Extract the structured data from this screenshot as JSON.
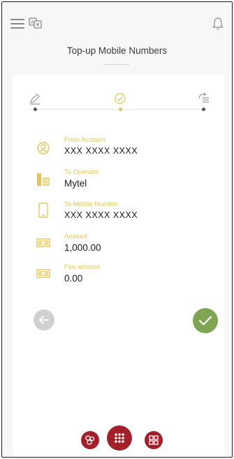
{
  "header": {
    "title": "Top-up Mobile Numbers",
    "subtitle_dots": "............"
  },
  "icons": {
    "menu": "hamburger-menu-icon",
    "language": "language-toggle-icon",
    "notifications": "bell-icon"
  },
  "stepper": {
    "steps": [
      {
        "icon": "pencil-icon",
        "state": "done"
      },
      {
        "icon": "check-circle-icon",
        "state": "active"
      },
      {
        "icon": "send-list-icon",
        "state": "pending"
      }
    ]
  },
  "fields": [
    {
      "label": "From Account",
      "value": "XXX XXXX XXXX",
      "icon": "user-circle-icon"
    },
    {
      "label": "To Operator",
      "value": "Mytel",
      "icon": "building-icon"
    },
    {
      "label": "To Mobile Number",
      "value": "XXX XXXX XXXX",
      "icon": "mobile-phone-icon"
    },
    {
      "label": "Amount",
      "value": "1,000.00",
      "icon": "banknote-icon"
    },
    {
      "label": "Fee amount",
      "value": "0.00",
      "icon": "banknote-icon"
    }
  ],
  "actions": {
    "back": "arrow-left-icon",
    "confirm": "checkmark-icon"
  },
  "bottom_nav": {
    "items": [
      "services-icon",
      "keypad-icon",
      "qr-code-icon"
    ]
  },
  "colors": {
    "accent_gold": "#e6c45a",
    "brand_red": "#a3202a",
    "confirm_green": "#7fa553",
    "back_gray": "#d0d0d0"
  }
}
